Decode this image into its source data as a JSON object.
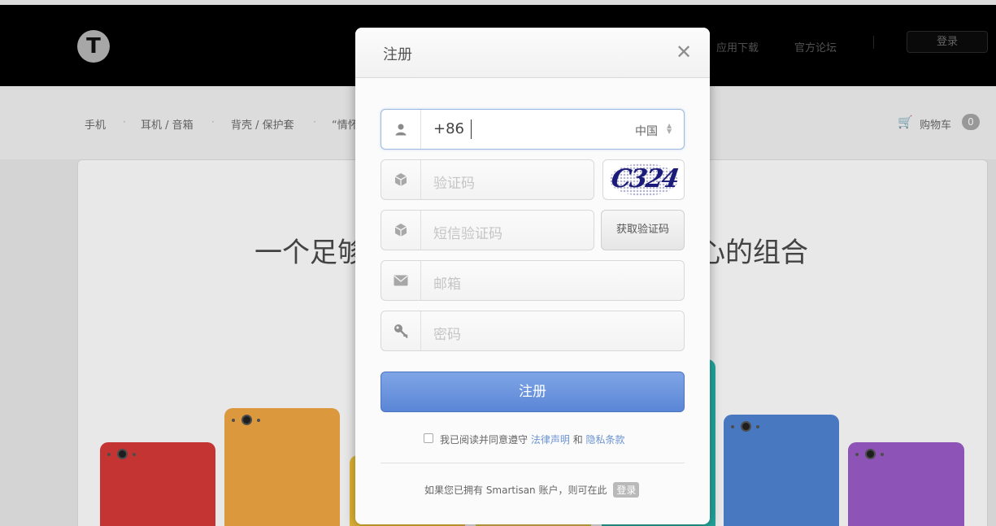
{
  "header": {
    "logo_glyph": "T",
    "links": [
      "应用下载",
      "官方论坛"
    ],
    "login_label": "登录"
  },
  "categories": {
    "items": [
      "手机",
      "耳机 / 音箱",
      "背壳 / 保护套",
      "“情怀"
    ],
    "separator": "·",
    "cart_label": "购物车",
    "cart_count": "0"
  },
  "hero": {
    "headline_left": "一个足够",
    "headline_right": "心的组合"
  },
  "phones": {
    "colors": [
      "#d83a38",
      "#f2a843",
      "#f3c43a",
      "#e9c94a",
      "#27b6ad",
      "#4f84d4",
      "#9b5cc8"
    ]
  },
  "modal": {
    "title": "注册",
    "close_glyph": "✕",
    "phone": {
      "icon": "user-icon",
      "value": "+86",
      "country": "中国"
    },
    "captcha_field": {
      "icon": "cube-icon",
      "placeholder": "验证码",
      "image_text": "C324"
    },
    "sms_field": {
      "icon": "cube-icon",
      "placeholder": "短信验证码",
      "button_label": "获取验证码"
    },
    "email_field": {
      "icon": "envelope-icon",
      "placeholder": "邮箱"
    },
    "password_field": {
      "icon": "key-icon",
      "placeholder": "密码"
    },
    "submit_label": "注册",
    "agreement": {
      "prefix": "我已阅读并同意遵守",
      "legal_link": "法律声明",
      "conjunction": "和",
      "privacy_link": "隐私条款"
    },
    "footer": {
      "text": "如果您已拥有 Smartisan 账户，则可在此",
      "login_label": "登录"
    }
  }
}
